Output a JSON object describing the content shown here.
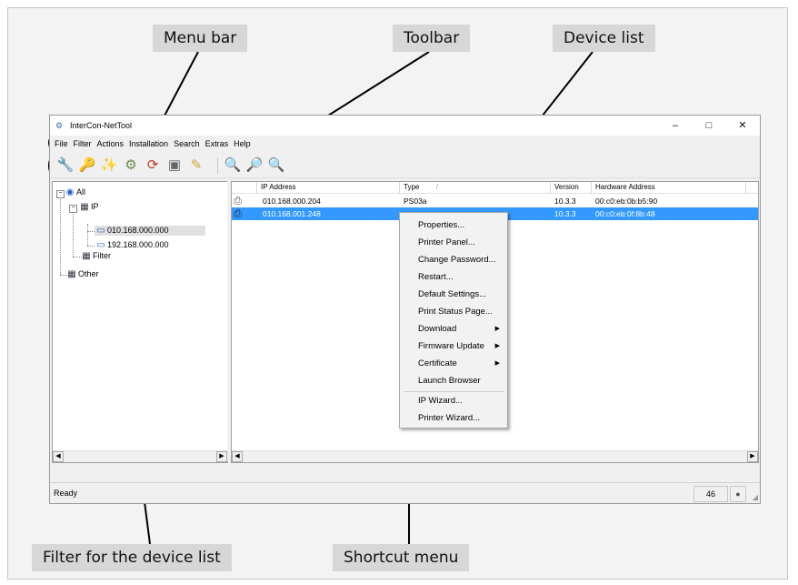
{
  "callouts": {
    "menu_bar": "Menu bar",
    "toolbar": "Toolbar",
    "device_list": "Device list",
    "filter": "Filter for the device list",
    "shortcut_menu": "Shortcut menu"
  },
  "window": {
    "title": "InterCon-NetTool",
    "icon": "network-app-icon",
    "controls": {
      "minimize": "–",
      "maximize": "□",
      "close": "✕"
    }
  },
  "menu": [
    "File",
    "Filter",
    "Actions",
    "Installation",
    "Search",
    "Extras",
    "Help"
  ],
  "toolbar_icons": [
    "wrench-icon",
    "key-icon",
    "wand-icon",
    "gear-icon",
    "refresh-icon",
    "device-icon",
    "printer-icon",
    "search-icon",
    "search-add-icon",
    "search-alt-icon"
  ],
  "tree": {
    "all": "All",
    "ip": "IP",
    "ip_1": "010.168.000.000",
    "ip_2": "192.168.000.000",
    "filter": "Filter",
    "other": "Other"
  },
  "list": {
    "columns": [
      "IP Address",
      "Type",
      "Version",
      "Hardware Address"
    ],
    "sort_indicator": "/",
    "rows": [
      {
        "ip": "010.168.000.204",
        "type": "PS03a",
        "version": "10.3.3",
        "hw": "00:c0:eb:0b:b5:90"
      },
      {
        "ip": "010.168.001.248",
        "type": "",
        "version": "10.3.3",
        "hw": "00:c0:eb:0f:8b:48"
      }
    ]
  },
  "status": {
    "text": "Ready",
    "count": "46",
    "indicator": "●"
  },
  "context_menu": {
    "items": [
      {
        "label": "Properties..."
      },
      {
        "label": "Printer Panel..."
      },
      {
        "label": "Change Password..."
      },
      {
        "label": "Restart..."
      },
      {
        "label": "Default Settings..."
      },
      {
        "label": "Print Status Page..."
      },
      {
        "label": "Download",
        "submenu": true
      },
      {
        "label": "Firmware Update",
        "submenu": true
      },
      {
        "label": "Certificate",
        "submenu": true
      },
      {
        "label": "Launch Browser"
      },
      {
        "label": "IP Wizard..."
      },
      {
        "label": "Printer Wizard..."
      }
    ],
    "submenu_arrow": "▶"
  },
  "colors": {
    "selection": "#3399ff",
    "callout_bg": "#d7d7d7",
    "frame_bg": "#f3f3f3"
  }
}
